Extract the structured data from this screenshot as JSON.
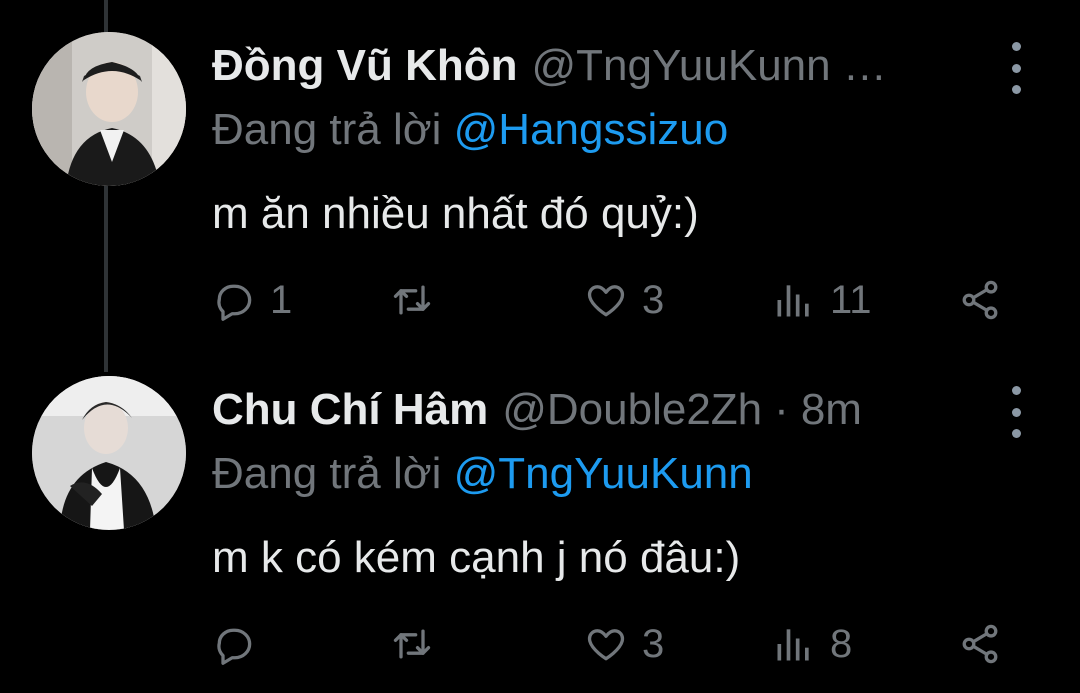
{
  "colors": {
    "background": "#000000",
    "primary_text": "#e7e9ea",
    "secondary_text": "#71767b",
    "mention": "#1d9bf0",
    "thread_line": "#2f3336"
  },
  "tweets": [
    {
      "display_name": "Đồng Vũ Khôn",
      "handle": "@TngYuuKunn …",
      "dot": "",
      "time": "",
      "reply_prefix": "Đang trả lời",
      "reply_to": "@Hangssizuo",
      "text": "m ăn nhiều nhất đó quỷ:)",
      "counts": {
        "replies": "1",
        "retweets": "",
        "likes": "3",
        "views": "11"
      },
      "icons": [
        "reply-icon",
        "retweet-icon",
        "like-icon",
        "views-icon",
        "share-icon"
      ]
    },
    {
      "display_name": "Chu Chí Hâm",
      "handle": "@Double2Zh",
      "dot": "·",
      "time": "8m",
      "reply_prefix": "Đang trả lời",
      "reply_to": "@TngYuuKunn",
      "text": "m k có kém cạnh j nó đâu:)",
      "counts": {
        "replies": "",
        "retweets": "",
        "likes": "3",
        "views": "8"
      },
      "icons": [
        "reply-icon",
        "retweet-icon",
        "like-icon",
        "views-icon",
        "share-icon"
      ]
    }
  ]
}
